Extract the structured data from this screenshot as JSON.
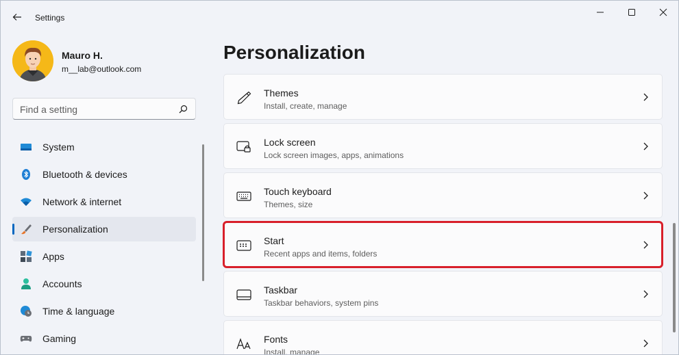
{
  "window": {
    "title": "Settings"
  },
  "profile": {
    "name": "Mauro H.",
    "email": "m__lab@outlook.com"
  },
  "search": {
    "placeholder": "Find a setting"
  },
  "sidebar": {
    "items": [
      {
        "label": "System",
        "icon": "monitor-icon"
      },
      {
        "label": "Bluetooth & devices",
        "icon": "bluetooth-icon"
      },
      {
        "label": "Network & internet",
        "icon": "wifi-icon"
      },
      {
        "label": "Personalization",
        "icon": "paintbrush-icon",
        "active": true
      },
      {
        "label": "Apps",
        "icon": "apps-icon"
      },
      {
        "label": "Accounts",
        "icon": "person-icon"
      },
      {
        "label": "Time & language",
        "icon": "globe-clock-icon"
      },
      {
        "label": "Gaming",
        "icon": "gamepad-icon"
      }
    ]
  },
  "main": {
    "title": "Personalization",
    "cards": [
      {
        "title": "Themes",
        "subtitle": "Install, create, manage",
        "icon": "pen-icon"
      },
      {
        "title": "Lock screen",
        "subtitle": "Lock screen images, apps, animations",
        "icon": "lock-screen-icon"
      },
      {
        "title": "Touch keyboard",
        "subtitle": "Themes, size",
        "icon": "keyboard-icon"
      },
      {
        "title": "Start",
        "subtitle": "Recent apps and items, folders",
        "icon": "start-menu-icon",
        "highlighted": true
      },
      {
        "title": "Taskbar",
        "subtitle": "Taskbar behaviors, system pins",
        "icon": "taskbar-icon"
      },
      {
        "title": "Fonts",
        "subtitle": "Install, manage",
        "icon": "fonts-icon"
      }
    ]
  },
  "colors": {
    "accent": "#0067c0",
    "highlight": "#d81f2a"
  }
}
